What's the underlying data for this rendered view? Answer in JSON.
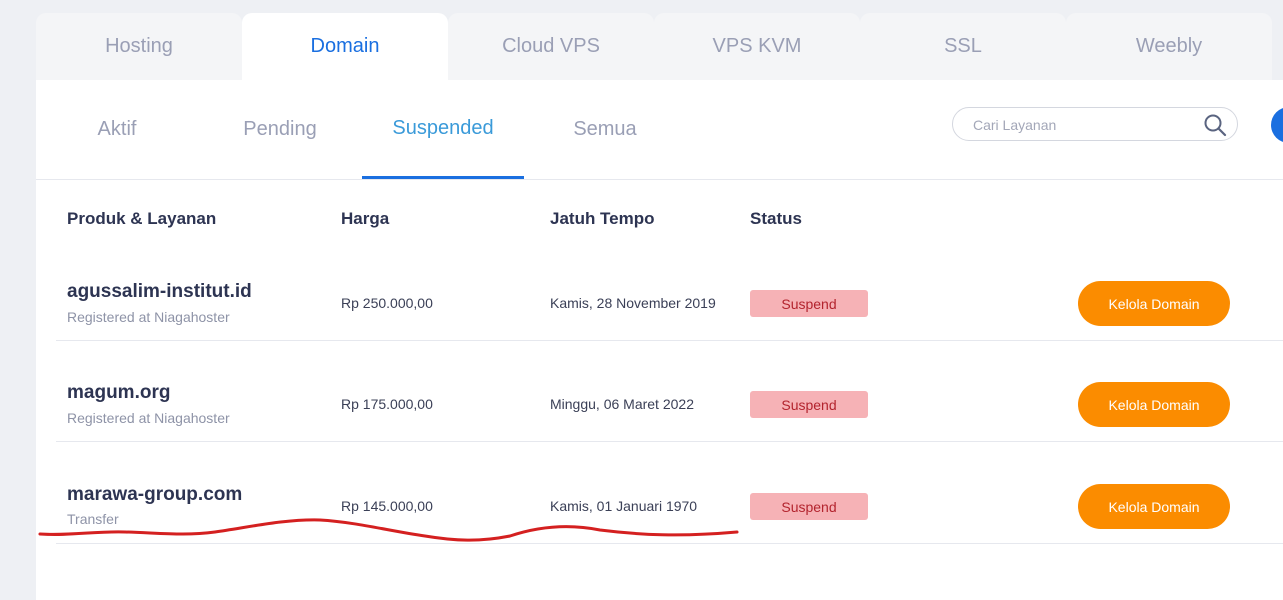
{
  "product_tabs": [
    {
      "label": "Hosting",
      "active": false
    },
    {
      "label": "Domain",
      "active": true
    },
    {
      "label": "Cloud VPS",
      "active": false
    },
    {
      "label": "VPS KVM",
      "active": false
    },
    {
      "label": "SSL",
      "active": false
    },
    {
      "label": "Weebly",
      "active": false
    }
  ],
  "status_tabs": [
    {
      "label": "Aktif",
      "active": false
    },
    {
      "label": "Pending",
      "active": false
    },
    {
      "label": "Suspended",
      "active": true
    },
    {
      "label": "Semua",
      "active": false
    }
  ],
  "search": {
    "placeholder": "Cari Layanan",
    "value": ""
  },
  "table": {
    "headers": [
      "Produk & Layanan",
      "Harga",
      "Jatuh Tempo",
      "Status"
    ],
    "rows": [
      {
        "name": "agussalim-institut.id",
        "sub": "Registered at Niagahoster",
        "price": "Rp 250.000,00",
        "due": "Kamis, 28 November 2019",
        "status": "Suspend",
        "action": "Kelola Domain"
      },
      {
        "name": "magum.org",
        "sub": "Registered at Niagahoster",
        "price": "Rp 175.000,00",
        "due": "Minggu, 06 Maret 2022",
        "status": "Suspend",
        "action": "Kelola Domain"
      },
      {
        "name": "marawa-group.com",
        "sub": "Transfer",
        "price": "Rp 145.000,00",
        "due": "Kamis, 01 Januari 1970",
        "status": "Suspend",
        "action": "Kelola Domain"
      }
    ]
  },
  "colors": {
    "accent": "#1a6fe0",
    "action_orange": "#fb8c00",
    "suspend_badge_bg": "#f6b2b6",
    "suspend_badge_text": "#b3242e",
    "annotation_red": "#d42020"
  }
}
